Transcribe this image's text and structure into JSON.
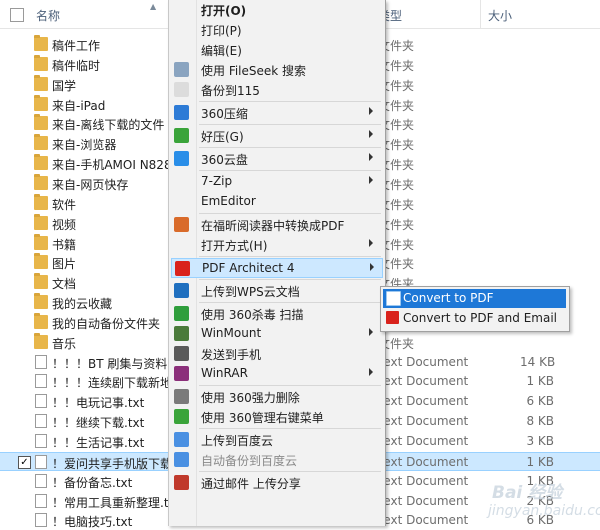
{
  "header": {
    "name": "名称",
    "type": "类型",
    "size": "大小"
  },
  "files": [
    {
      "name": "稿件工作",
      "type": "文件夹",
      "size": "",
      "kind": "folder"
    },
    {
      "name": "稿件临时",
      "type": "文件夹",
      "size": "",
      "kind": "folder"
    },
    {
      "name": "国学",
      "type": "文件夹",
      "size": "",
      "kind": "folder"
    },
    {
      "name": "来自-iPad",
      "type": "文件夹",
      "size": "",
      "kind": "folder"
    },
    {
      "name": "来自-离线下载的文件",
      "type": "文件夹",
      "size": "",
      "kind": "folder"
    },
    {
      "name": "来自-浏览器",
      "type": "文件夹",
      "size": "",
      "kind": "folder"
    },
    {
      "name": "来自-手机AMOI N828",
      "type": "文件夹",
      "size": "",
      "kind": "folder"
    },
    {
      "name": "来自-网页快存",
      "type": "文件夹",
      "size": "",
      "kind": "folder"
    },
    {
      "name": "软件",
      "type": "文件夹",
      "size": "",
      "kind": "folder"
    },
    {
      "name": "视频",
      "type": "文件夹",
      "size": "",
      "kind": "folder"
    },
    {
      "name": "书籍",
      "type": "文件夹",
      "size": "",
      "kind": "folder"
    },
    {
      "name": "图片",
      "type": "文件夹",
      "size": "",
      "kind": "folder"
    },
    {
      "name": "文档",
      "type": "文件夹",
      "size": "",
      "kind": "folder"
    },
    {
      "name": "我的云收藏",
      "type": "文件夹",
      "size": "",
      "kind": "folder"
    },
    {
      "name": "我的自动备份文件夹",
      "type": "文件夹",
      "size": "",
      "kind": "folder"
    },
    {
      "name": "音乐",
      "type": "文件夹",
      "size": "",
      "kind": "folder"
    },
    {
      "name": "！！！BT 刷集与资料下",
      "type": "Text Document",
      "size": "14 KB",
      "kind": "doc"
    },
    {
      "name": "！！！连续剧下载新地址",
      "type": "Text Document",
      "size": "1 KB",
      "kind": "doc"
    },
    {
      "name": "！！电玩记事.txt",
      "type": "Text Document",
      "size": "6 KB",
      "kind": "doc"
    },
    {
      "name": "！！继续下载.txt",
      "type": "Text Document",
      "size": "8 KB",
      "kind": "doc"
    },
    {
      "name": "！！生活记事.txt",
      "type": "Text Document",
      "size": "3 KB",
      "kind": "doc"
    },
    {
      "name": "！爱问共享手机版下载",
      "type": "Text Document",
      "size": "1 KB",
      "kind": "doc",
      "selected": true
    },
    {
      "name": "！备份备忘.txt",
      "type": "Text Document",
      "size": "1 KB",
      "kind": "doc"
    },
    {
      "name": "！常用工具重新整理.txt",
      "type": "Text Document",
      "size": "2 KB",
      "kind": "doc"
    },
    {
      "name": "！电脑技巧.txt",
      "type": "Text Document",
      "size": "6 KB",
      "kind": "doc"
    }
  ],
  "menu": [
    {
      "label": "打开(O)",
      "bold": true,
      "icon": "none"
    },
    {
      "label": "打印(P)",
      "icon": "none"
    },
    {
      "label": "编辑(E)",
      "icon": "none"
    },
    {
      "label": "使用 FileSeek 搜索",
      "icon": "magnifier-icon"
    },
    {
      "label": "备份到115",
      "icon": "page-icon"
    },
    {
      "sep": true
    },
    {
      "label": "360压缩",
      "icon": "compress-icon",
      "sub": true
    },
    {
      "sep": true
    },
    {
      "label": "好压(G)",
      "icon": "haozip-icon",
      "sub": true
    },
    {
      "sep": true
    },
    {
      "label": "360云盘",
      "icon": "cloud-icon",
      "sub": true
    },
    {
      "sep": true
    },
    {
      "label": "7-Zip",
      "icon": "none",
      "sub": true
    },
    {
      "label": "EmEditor",
      "icon": "none"
    },
    {
      "sep": true
    },
    {
      "label": "在福昕阅读器中转换成PDF",
      "icon": "foxit-icon"
    },
    {
      "label": "打开方式(H)",
      "icon": "none",
      "sub": true
    },
    {
      "sep": true
    },
    {
      "label": "PDF Architect 4",
      "icon": "pdf-architect-icon",
      "sub": true,
      "highlight": true
    },
    {
      "sep": true
    },
    {
      "label": "上传到WPS云文档",
      "icon": "wps-icon"
    },
    {
      "sep": true
    },
    {
      "label": "使用 360杀毒 扫描",
      "icon": "shield-icon"
    },
    {
      "label": "WinMount",
      "icon": "winmount-icon",
      "sub": true
    },
    {
      "label": "发送到手机",
      "icon": "phone-icon"
    },
    {
      "label": "WinRAR",
      "icon": "winrar-icon",
      "sub": true
    },
    {
      "sep": true
    },
    {
      "label": "使用 360强力删除",
      "icon": "shredder-icon"
    },
    {
      "label": "使用 360管理右键菜单",
      "icon": "manage-icon"
    },
    {
      "sep": true
    },
    {
      "label": "上传到百度云",
      "icon": "baidu-icon"
    },
    {
      "label": "自动备份到百度云",
      "icon": "baidu-icon",
      "disabled": true
    },
    {
      "sep": true
    },
    {
      "label": "通过邮件 上传分享",
      "icon": "mail-icon"
    }
  ],
  "submenu": [
    {
      "label": "Convert to PDF",
      "icon": "pdf-convert-icon",
      "highlight": true
    },
    {
      "label": "Convert to PDF and Email",
      "icon": "pdf-email-icon"
    }
  ],
  "watermark": {
    "line1": "Bai 经验",
    "line2": "jingyan.baidu.com"
  },
  "colors": {
    "selection": "#cce8ff",
    "submenu_highlight": "#1e78d7",
    "folder": "#e8b64a"
  }
}
